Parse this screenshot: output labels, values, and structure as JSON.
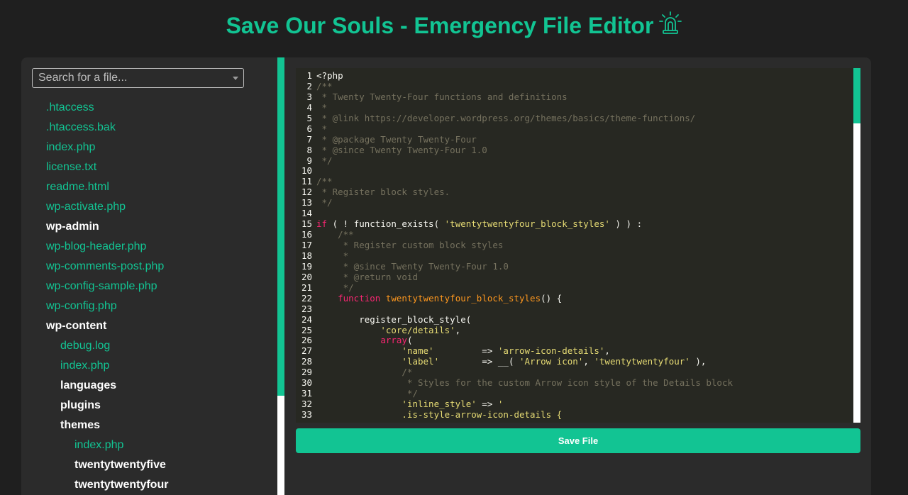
{
  "header": {
    "title": "Save Our Souls - Emergency File Editor",
    "icon": "siren-icon"
  },
  "search": {
    "placeholder": "Search for a file..."
  },
  "file_tree": [
    {
      "label": ".htaccess",
      "type": "file",
      "depth": 0
    },
    {
      "label": ".htaccess.bak",
      "type": "file",
      "depth": 0
    },
    {
      "label": "index.php",
      "type": "file",
      "depth": 0
    },
    {
      "label": "license.txt",
      "type": "file",
      "depth": 0
    },
    {
      "label": "readme.html",
      "type": "file",
      "depth": 0
    },
    {
      "label": "wp-activate.php",
      "type": "file",
      "depth": 0
    },
    {
      "label": "wp-admin",
      "type": "dir",
      "depth": 0
    },
    {
      "label": "wp-blog-header.php",
      "type": "file",
      "depth": 0
    },
    {
      "label": "wp-comments-post.php",
      "type": "file",
      "depth": 0
    },
    {
      "label": "wp-config-sample.php",
      "type": "file",
      "depth": 0
    },
    {
      "label": "wp-config.php",
      "type": "file",
      "depth": 0
    },
    {
      "label": "wp-content",
      "type": "dir",
      "depth": 0
    },
    {
      "label": "debug.log",
      "type": "file",
      "depth": 1
    },
    {
      "label": "index.php",
      "type": "file",
      "depth": 1
    },
    {
      "label": "languages",
      "type": "dir",
      "depth": 1
    },
    {
      "label": "plugins",
      "type": "dir",
      "depth": 1
    },
    {
      "label": "themes",
      "type": "dir",
      "depth": 1
    },
    {
      "label": "index.php",
      "type": "file",
      "depth": 2
    },
    {
      "label": "twentytwentyfive",
      "type": "dir",
      "depth": 2
    },
    {
      "label": "twentytwentyfour",
      "type": "dir",
      "depth": 2
    }
  ],
  "editor": {
    "lines": [
      [
        [
          "txt",
          "<?php"
        ]
      ],
      [
        [
          "c-cm",
          "/**"
        ]
      ],
      [
        [
          "c-cm",
          " * Twenty Twenty-Four functions and definitions"
        ]
      ],
      [
        [
          "c-cm",
          " *"
        ]
      ],
      [
        [
          "c-cm",
          " * @link https://developer.wordpress.org/themes/basics/theme-functions/"
        ]
      ],
      [
        [
          "c-cm",
          " *"
        ]
      ],
      [
        [
          "c-cm",
          " * @package Twenty Twenty-Four"
        ]
      ],
      [
        [
          "c-cm",
          " * @since Twenty Twenty-Four 1.0"
        ]
      ],
      [
        [
          "c-cm",
          " */"
        ]
      ],
      [
        [
          "txt",
          ""
        ]
      ],
      [
        [
          "c-cm",
          "/**"
        ]
      ],
      [
        [
          "c-cm",
          " * Register block styles."
        ]
      ],
      [
        [
          "c-cm",
          " */"
        ]
      ],
      [
        [
          "txt",
          ""
        ]
      ],
      [
        [
          "c-kw",
          "if"
        ],
        [
          "txt",
          " ( ! function_exists( "
        ],
        [
          "c-str",
          "'twentytwentyfour_block_styles'"
        ],
        [
          "txt",
          " ) ) :"
        ]
      ],
      [
        [
          "c-cm",
          "    /**"
        ]
      ],
      [
        [
          "c-cm",
          "     * Register custom block styles"
        ]
      ],
      [
        [
          "c-cm",
          "     *"
        ]
      ],
      [
        [
          "c-cm",
          "     * @since Twenty Twenty-Four 1.0"
        ]
      ],
      [
        [
          "c-cm",
          "     * @return void"
        ]
      ],
      [
        [
          "c-cm",
          "     */"
        ]
      ],
      [
        [
          "txt",
          "    "
        ],
        [
          "c-kw",
          "function"
        ],
        [
          "txt",
          " "
        ],
        [
          "c-fn",
          "twentytwentyfour_block_styles"
        ],
        [
          "txt",
          "() {"
        ]
      ],
      [
        [
          "txt",
          ""
        ]
      ],
      [
        [
          "txt",
          "        register_block_style("
        ]
      ],
      [
        [
          "txt",
          "            "
        ],
        [
          "c-str",
          "'core/details'"
        ],
        [
          "txt",
          ","
        ]
      ],
      [
        [
          "txt",
          "            "
        ],
        [
          "c-kw",
          "array"
        ],
        [
          "txt",
          "("
        ]
      ],
      [
        [
          "txt",
          "                "
        ],
        [
          "c-str",
          "'name'"
        ],
        [
          "txt",
          "         => "
        ],
        [
          "c-str",
          "'arrow-icon-details'"
        ],
        [
          "txt",
          ","
        ]
      ],
      [
        [
          "txt",
          "                "
        ],
        [
          "c-str",
          "'label'"
        ],
        [
          "txt",
          "        => __( "
        ],
        [
          "c-str",
          "'Arrow icon'"
        ],
        [
          "txt",
          ", "
        ],
        [
          "c-str",
          "'twentytwentyfour'"
        ],
        [
          "txt",
          " ),"
        ]
      ],
      [
        [
          "c-cm",
          "                /*"
        ]
      ],
      [
        [
          "c-cm",
          "                 * Styles for the custom Arrow icon style of the Details block"
        ]
      ],
      [
        [
          "c-cm",
          "                 */"
        ]
      ],
      [
        [
          "txt",
          "                "
        ],
        [
          "c-str",
          "'inline_style'"
        ],
        [
          "txt",
          " => "
        ],
        [
          "c-str",
          "'"
        ]
      ],
      [
        [
          "c-str",
          "                .is-style-arrow-icon-details {"
        ]
      ]
    ],
    "start_line": 1
  },
  "save_button": {
    "label": "Save File"
  },
  "colors": {
    "accent": "#12c493",
    "background": "#1f1f1f",
    "panel": "#2b2b2b",
    "editor_bg": "#272822"
  }
}
